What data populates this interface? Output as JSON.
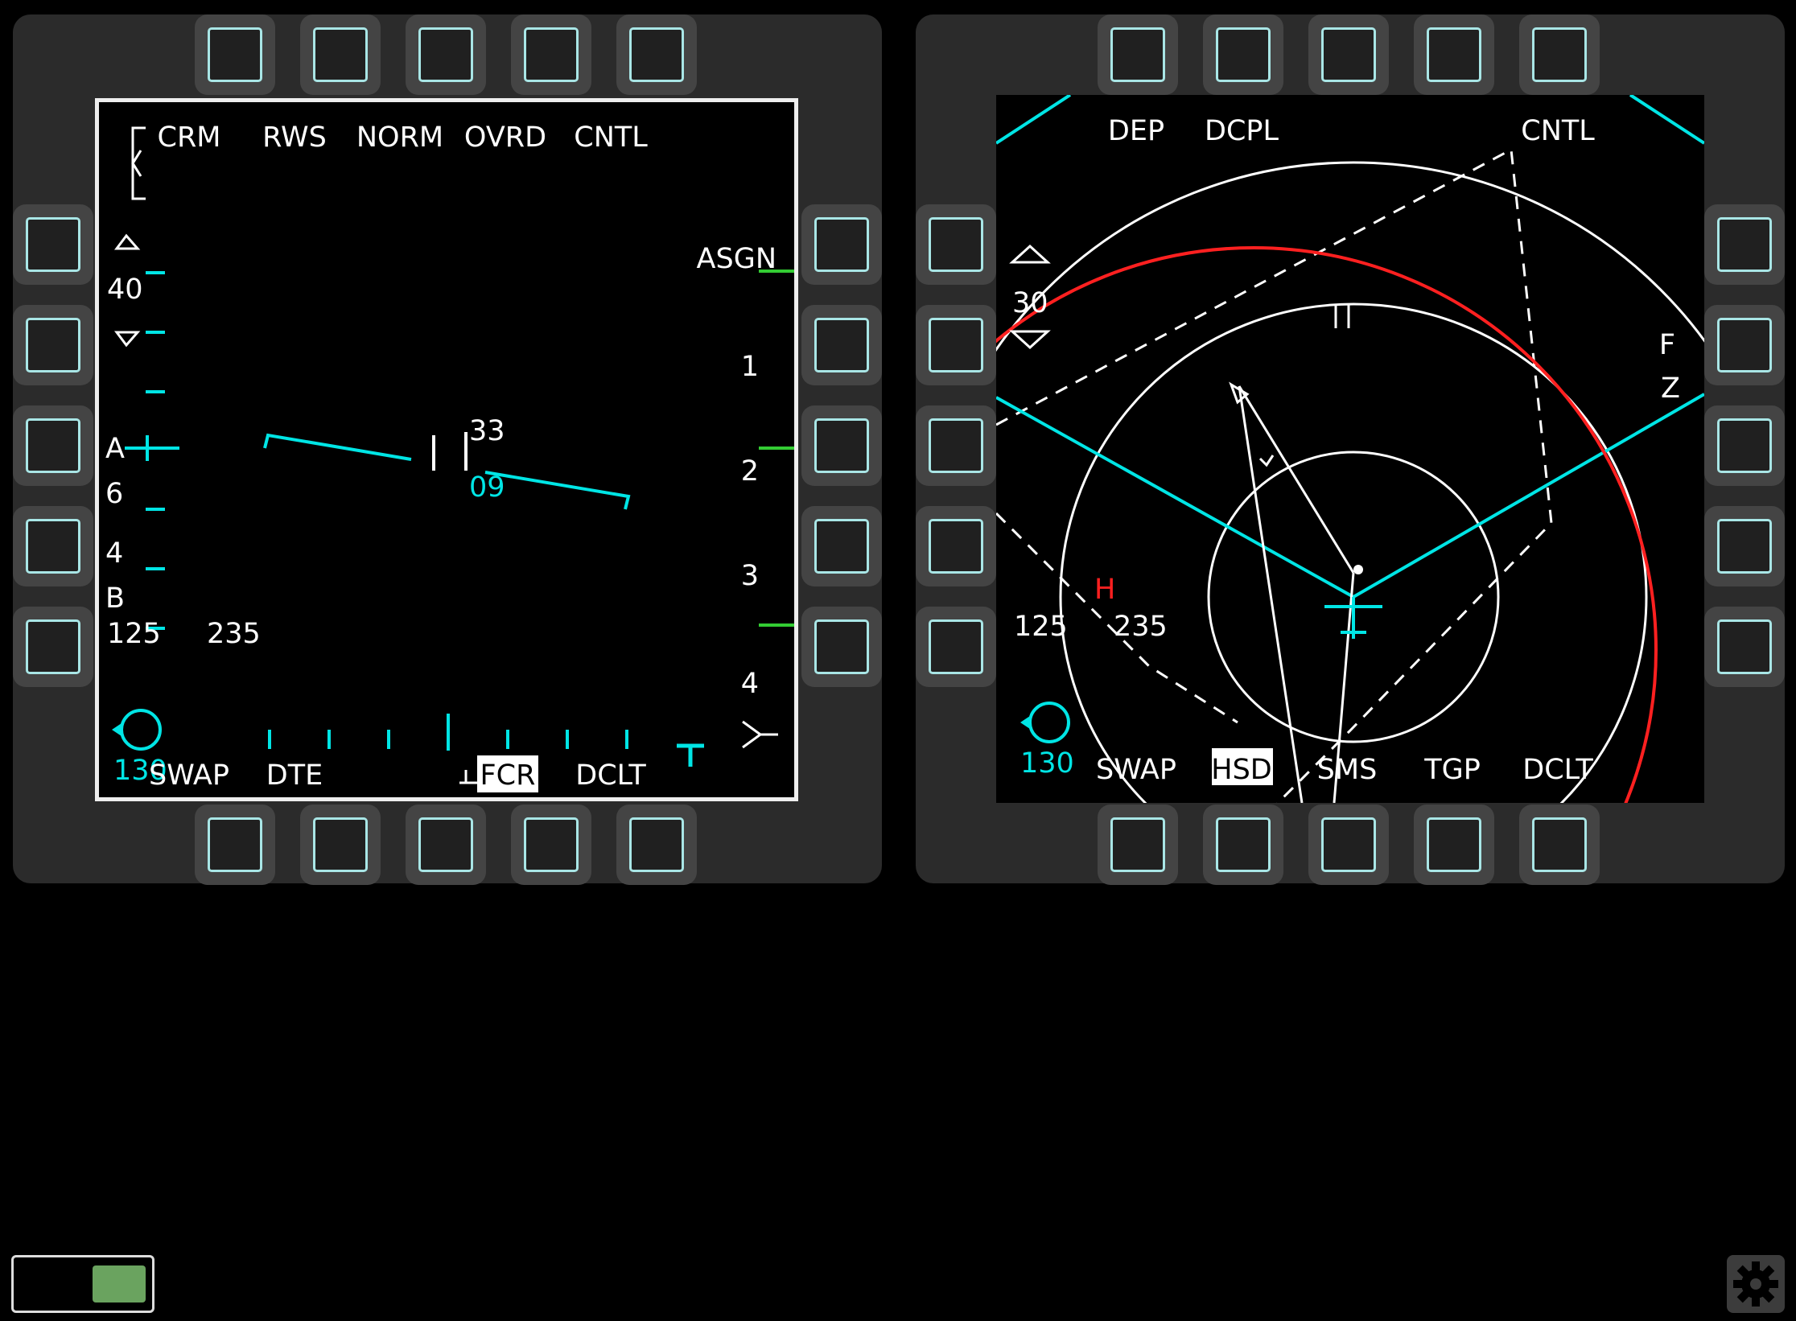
{
  "colors": {
    "cyan": "#00e5e5",
    "white": "#ffffff",
    "red": "#ff2020",
    "green": "#33cc33",
    "osb_border": "#a9e6e6"
  },
  "left_mfd": {
    "top_labels": [
      "CRM",
      "RWS",
      "NORM",
      "OVRD",
      "CNTL"
    ],
    "bottom_labels": [
      "SWAP",
      "DTE",
      "",
      "FCR",
      "DCLT"
    ],
    "bottom_selected": "FCR",
    "right_labels": [
      "ASGN"
    ],
    "range_scale": "40",
    "left_side_marks": [
      "A",
      "6",
      "4",
      "B"
    ],
    "altitude_readout": "125",
    "heading_readout": "235",
    "fuel_readout": "130",
    "bullseye_range_top": "33",
    "bullseye_range_bottom": "09",
    "scale_numbers": [
      "1",
      "2",
      "3",
      "4"
    ],
    "osb_icon": "square-button-icon"
  },
  "right_mfd": {
    "top_labels": [
      "DEP",
      "DCPL",
      "",
      "",
      "CNTL"
    ],
    "bottom_labels": [
      "SWAP",
      "HSD",
      "SMS",
      "TGP",
      "DCLT"
    ],
    "bottom_selected": "HSD",
    "range_scale": "30",
    "right_side_marks": [
      "F",
      "Z"
    ],
    "threat_symbol": "H",
    "altitude_readout": "125",
    "heading_readout": "235",
    "fuel_readout": "130"
  },
  "controls": {
    "toggle_state": "on",
    "settings_icon": "gear-icon"
  }
}
